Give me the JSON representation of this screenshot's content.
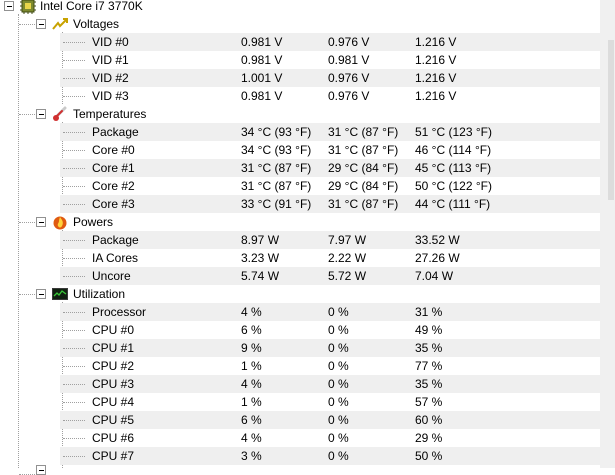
{
  "cpu": {
    "name": "Intel Core i7 3770K",
    "icon": "cpu-chip-icon"
  },
  "groups": [
    {
      "label": "Voltages",
      "icon": "voltage-icon",
      "rows": [
        {
          "label": "VID #0",
          "v1": "0.981 V",
          "v2": "0.976 V",
          "v3": "1.216 V"
        },
        {
          "label": "VID #1",
          "v1": "0.981 V",
          "v2": "0.981 V",
          "v3": "1.216 V"
        },
        {
          "label": "VID #2",
          "v1": "1.001 V",
          "v2": "0.976 V",
          "v3": "1.216 V"
        },
        {
          "label": "VID #3",
          "v1": "0.981 V",
          "v2": "0.976 V",
          "v3": "1.216 V"
        }
      ]
    },
    {
      "label": "Temperatures",
      "icon": "thermometer-icon",
      "rows": [
        {
          "label": "Package",
          "v1": "34 °C  (93 °F)",
          "v2": "31 °C  (87 °F)",
          "v3": "51 °C  (123 °F)"
        },
        {
          "label": "Core #0",
          "v1": "34 °C  (93 °F)",
          "v2": "31 °C  (87 °F)",
          "v3": "46 °C  (114 °F)"
        },
        {
          "label": "Core #1",
          "v1": "31 °C  (87 °F)",
          "v2": "29 °C  (84 °F)",
          "v3": "45 °C  (113 °F)"
        },
        {
          "label": "Core #2",
          "v1": "31 °C  (87 °F)",
          "v2": "29 °C  (84 °F)",
          "v3": "50 °C  (122 °F)"
        },
        {
          "label": "Core #3",
          "v1": "33 °C  (91 °F)",
          "v2": "31 °C  (87 °F)",
          "v3": "44 °C  (111 °F)"
        }
      ]
    },
    {
      "label": "Powers",
      "icon": "power-flame-icon",
      "rows": [
        {
          "label": "Package",
          "v1": "8.97 W",
          "v2": "7.97 W",
          "v3": "33.52 W"
        },
        {
          "label": "IA Cores",
          "v1": "3.23 W",
          "v2": "2.22 W",
          "v3": "27.26 W"
        },
        {
          "label": "Uncore",
          "v1": "5.74 W",
          "v2": "5.72 W",
          "v3": "7.04 W"
        }
      ]
    },
    {
      "label": "Utilization",
      "icon": "utilization-monitor-icon",
      "rows": [
        {
          "label": "Processor",
          "v1": "4 %",
          "v2": "0 %",
          "v3": "31 %"
        },
        {
          "label": "CPU #0",
          "v1": "6 %",
          "v2": "0 %",
          "v3": "49 %"
        },
        {
          "label": "CPU #1",
          "v1": "9 %",
          "v2": "0 %",
          "v3": "35 %"
        },
        {
          "label": "CPU #2",
          "v1": "1 %",
          "v2": "0 %",
          "v3": "77 %"
        },
        {
          "label": "CPU #3",
          "v1": "4 %",
          "v2": "0 %",
          "v3": "35 %"
        },
        {
          "label": "CPU #4",
          "v1": "1 %",
          "v2": "0 %",
          "v3": "57 %"
        },
        {
          "label": "CPU #5",
          "v1": "6 %",
          "v2": "0 %",
          "v3": "60 %"
        },
        {
          "label": "CPU #6",
          "v1": "4 %",
          "v2": "0 %",
          "v3": "29 %"
        },
        {
          "label": "CPU #7",
          "v1": "3 %",
          "v2": "0 %",
          "v3": "50 %"
        }
      ]
    }
  ],
  "colors": {
    "row_shade": "#efefef",
    "tree_line": "#a0a0a0",
    "voltage_icon": "#c8a200",
    "thermometer_icon": "#d03030",
    "power_icon": "#e05a10",
    "utilization_icon": "#1e7a1e"
  }
}
